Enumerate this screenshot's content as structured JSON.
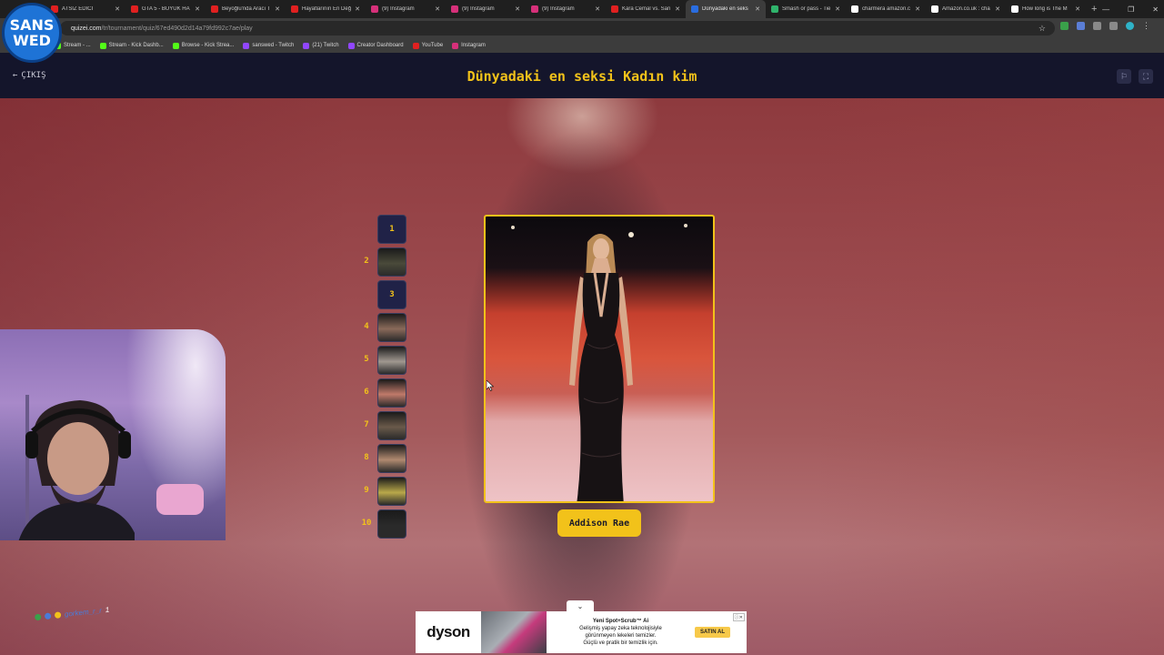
{
  "browser": {
    "tabs": [
      {
        "label": "ATSIZ EDİCİ",
        "favicon_color": "#e02020"
      },
      {
        "label": "GTA 5 - BÜYÜK HA",
        "favicon_color": "#e02020"
      },
      {
        "label": "Beyoğlu'nda Aracı T",
        "favicon_color": "#e02020"
      },
      {
        "label": "Hayatlarının En Değ",
        "favicon_color": "#e02020"
      },
      {
        "label": "(9) Instagram",
        "favicon_color": "#d6307a"
      },
      {
        "label": "(9) Instagram",
        "favicon_color": "#d6307a"
      },
      {
        "label": "(9) Instagram",
        "favicon_color": "#d6307a"
      },
      {
        "label": "Kara Cemal vs. San",
        "favicon_color": "#e02020"
      },
      {
        "label": "Dünyadaki en seks",
        "favicon_color": "#2a6de0",
        "active": true
      },
      {
        "label": "Smash or pass - Tie",
        "favicon_color": "#2fb36b"
      },
      {
        "label": "charmera amazon.c",
        "favicon_color": "#ffffff"
      },
      {
        "label": "Amazon.co.uk : cha",
        "favicon_color": "#ffffff"
      },
      {
        "label": "How long is The M",
        "favicon_color": "#ffffff"
      }
    ],
    "new_tab_symbol": "+",
    "window_controls": [
      "—",
      "❐",
      "✕"
    ],
    "url_host": "quizei.com",
    "url_path": "/tr/tournament/quiz/67ed490d2d14a79fd992c7ae/play",
    "bookmarks": [
      {
        "label": "Stream - ...",
        "color": "#53fc18"
      },
      {
        "label": "Stream - Kick Dashb...",
        "color": "#53fc18"
      },
      {
        "label": "Browse - Kick Strea...",
        "color": "#53fc18"
      },
      {
        "label": "sanswed - Twitch",
        "color": "#9146ff"
      },
      {
        "label": "(21) Twitch",
        "color": "#9146ff"
      },
      {
        "label": "Creator Dashboard",
        "color": "#9146ff"
      },
      {
        "label": "YouTube",
        "color": "#e02020"
      },
      {
        "label": "Instagram",
        "color": "#d6307a"
      }
    ]
  },
  "overlay": {
    "logo_line1": "SANS",
    "logo_line2": "WED",
    "chat_username": "gorkem_r_r",
    "chat_badge_count": "1"
  },
  "quiz": {
    "exit_label": "ÇIKIŞ",
    "title": "Dünyadaki en seksi Kadın kim",
    "accent_color": "#f2c21a",
    "header_icons": [
      "flag-icon",
      "fullscreen-icon"
    ],
    "bracket": [
      {
        "num": "1",
        "type": "number"
      },
      {
        "num": "2",
        "type": "thumb",
        "tone": "#4a4a3a"
      },
      {
        "num": "3",
        "type": "number"
      },
      {
        "num": "4",
        "type": "thumb",
        "tone": "#8a6a5a"
      },
      {
        "num": "5",
        "type": "thumb",
        "tone": "#a09890"
      },
      {
        "num": "6",
        "type": "thumb",
        "tone": "#c07a6a"
      },
      {
        "num": "7",
        "type": "thumb",
        "tone": "#6a5a4a"
      },
      {
        "num": "8",
        "type": "thumb",
        "tone": "#b08a70"
      },
      {
        "num": "9",
        "type": "thumb",
        "tone": "#b9a84a"
      },
      {
        "num": "10",
        "type": "thumb",
        "tone": "#2a2a2a"
      }
    ],
    "candidate_name": "Addison Rae"
  },
  "ad": {
    "brand": "dyson",
    "line1": "Yeni Spot+Scrub™ Ai",
    "line2": "Gelişmiş yapay zeka teknolojisiyle",
    "line3": "görünmeyen lekeleri temizler.",
    "line4": "Güçlü ve pratik bir temizlik için.",
    "cta": "SATIN AL",
    "badge": "ⓘ✕",
    "collapse_symbol": "⌄"
  }
}
